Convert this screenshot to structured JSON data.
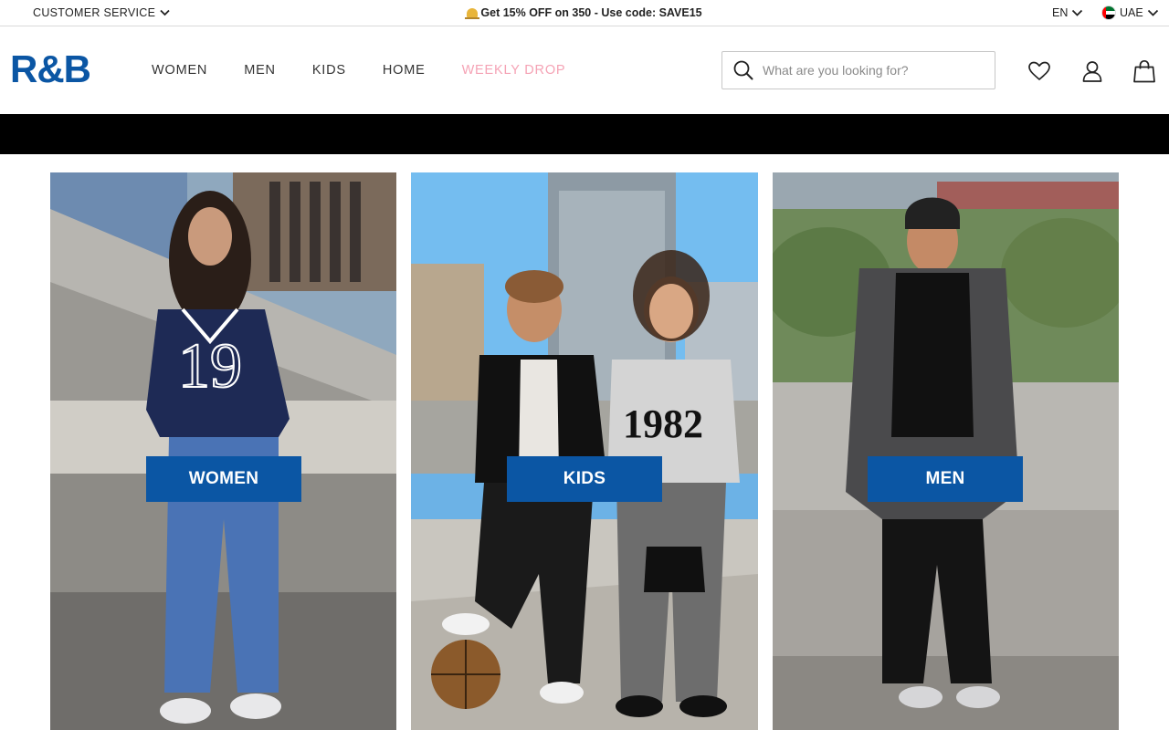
{
  "topbar": {
    "customer_service": "CUSTOMER SERVICE",
    "promo_text": "Get 15% OFF on 350 - Use code: SAVE15",
    "language": "EN",
    "country": "UAE"
  },
  "header": {
    "logo": "R&B",
    "nav": [
      "WOMEN",
      "MEN",
      "KIDS",
      "HOME",
      "WEEKLY DROP"
    ],
    "search_placeholder": "What are you looking for?",
    "icons": [
      "heart-icon",
      "user-icon",
      "bag-icon"
    ]
  },
  "categories": [
    {
      "label": "WOMEN"
    },
    {
      "label": "KIDS"
    },
    {
      "label": "MEN"
    }
  ],
  "colors": {
    "brand_blue": "#0b56a4",
    "weekly_drop_pink": "#f5a3b5",
    "banner_black": "#000000"
  }
}
